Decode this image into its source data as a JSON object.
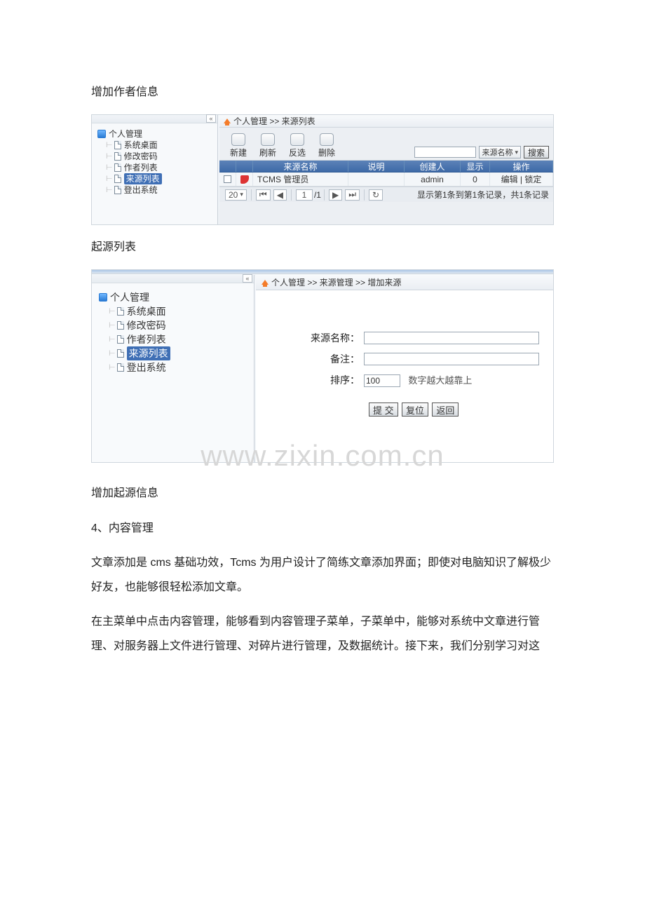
{
  "doc": {
    "title1": "增加作者信息",
    "caption1": "起源列表",
    "caption2": "增加起源信息",
    "section_num": "4",
    "section_title": "、内容管理",
    "para1": "文章添加是 cms 基础功效，Tcms 为用户设计了简练文章添加界面；即使对电脑知识了解极少好友，也能够很轻松添加文章。",
    "para2": "在主菜单中点击内容管理，能够看到内容管理子菜单，子菜单中，能够对系统中文章进行管理、对服务器上文件进行管理、对碎片进行管理，及数据统计。接下来，我们分别学习对这",
    "watermark": "www.zixin.com.cn"
  },
  "ss1": {
    "tree_root": "个人管理",
    "tree_items": [
      "系统桌面",
      "修改密码",
      "作者列表",
      "来源列表",
      "登出系统"
    ],
    "tree_selected_index": 3,
    "breadcrumb": "个人管理  >> 来源列表",
    "tools": [
      "新建",
      "刷新",
      "反选",
      "删除"
    ],
    "search_filter_options": [
      "来源名称"
    ],
    "search_filter_selected": "来源名称",
    "search_btn": "搜索",
    "cols": [
      "",
      "",
      "来源名称",
      "说明",
      "创建人",
      "显示",
      "操作"
    ],
    "row": {
      "name": "TCMS 管理员",
      "desc": "",
      "creator": "admin",
      "show": "0",
      "ops": "编辑 | 锁定"
    },
    "pager": {
      "pagesize": "20",
      "page": "1",
      "total_pages": "/1",
      "summary": "显示第1条到第1条记录，共1条记录"
    }
  },
  "ss2": {
    "tree_root": "个人管理",
    "tree_items": [
      "系统桌面",
      "修改密码",
      "作者列表",
      "来源列表",
      "登出系统"
    ],
    "tree_selected_index": 3,
    "breadcrumb": "个人管理  >> 来源管理  >> 增加来源",
    "fields": {
      "name_label": "来源名称：",
      "remark_label": "备注：",
      "order_label": "排序：",
      "order_value": "100",
      "order_hint": "数字越大越靠上"
    },
    "buttons": {
      "submit": "提  交",
      "reset": "复位",
      "back": "返回"
    }
  }
}
